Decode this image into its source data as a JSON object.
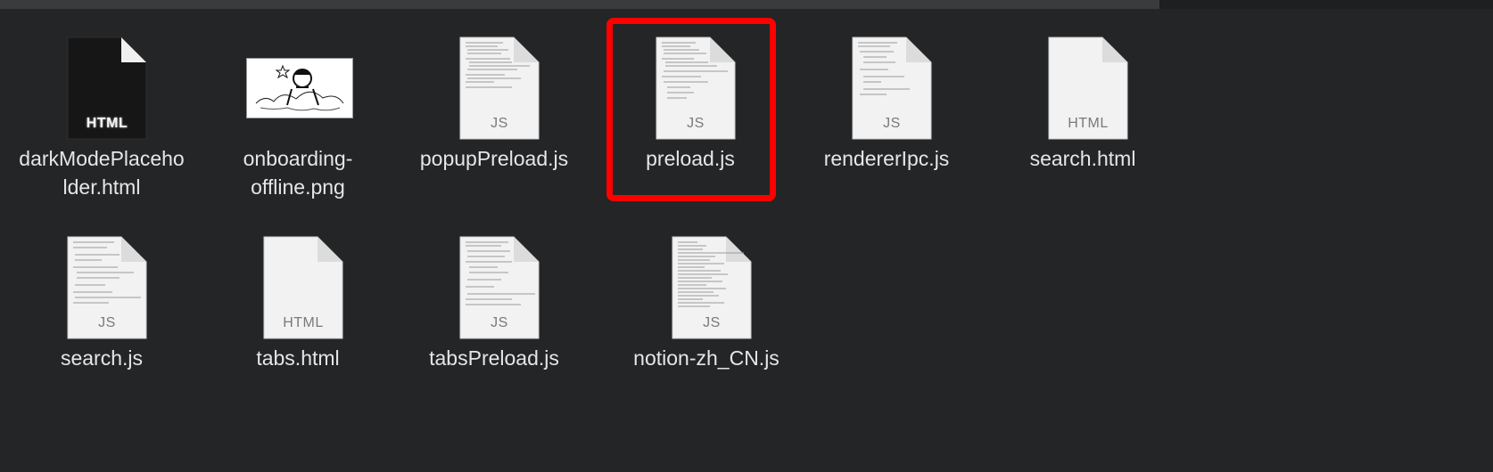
{
  "files": [
    {
      "name": "darkModePlaceholder.html",
      "label": "darkModePlaceho\nlder.html",
      "ext": "HTML",
      "kind": "html-dark"
    },
    {
      "name": "onboarding-offline.png",
      "label": "onboarding-\noffline.png",
      "ext": "",
      "kind": "image"
    },
    {
      "name": "popupPreload.js",
      "label": "popupPreload.js",
      "ext": "JS",
      "kind": "js"
    },
    {
      "name": "preload.js",
      "label": "preload.js",
      "ext": "JS",
      "kind": "js",
      "selected": true
    },
    {
      "name": "rendererIpc.js",
      "label": "rendererIpc.js",
      "ext": "JS",
      "kind": "js"
    },
    {
      "name": "search.html",
      "label": "search.html",
      "ext": "HTML",
      "kind": "html"
    },
    {
      "name": "search.js",
      "label": "search.js",
      "ext": "JS",
      "kind": "js"
    },
    {
      "name": "tabs.html",
      "label": "tabs.html",
      "ext": "HTML",
      "kind": "html"
    },
    {
      "name": "tabsPreload.js",
      "label": "tabsPreload.js",
      "ext": "JS",
      "kind": "js"
    },
    {
      "name": "notion-zh_CN.js",
      "label": "notion-zh_CN.js",
      "ext": "JS",
      "kind": "js"
    }
  ],
  "colors": {
    "background": "#242526",
    "highlight": "#ff0000",
    "label": "#e6e6e6"
  }
}
